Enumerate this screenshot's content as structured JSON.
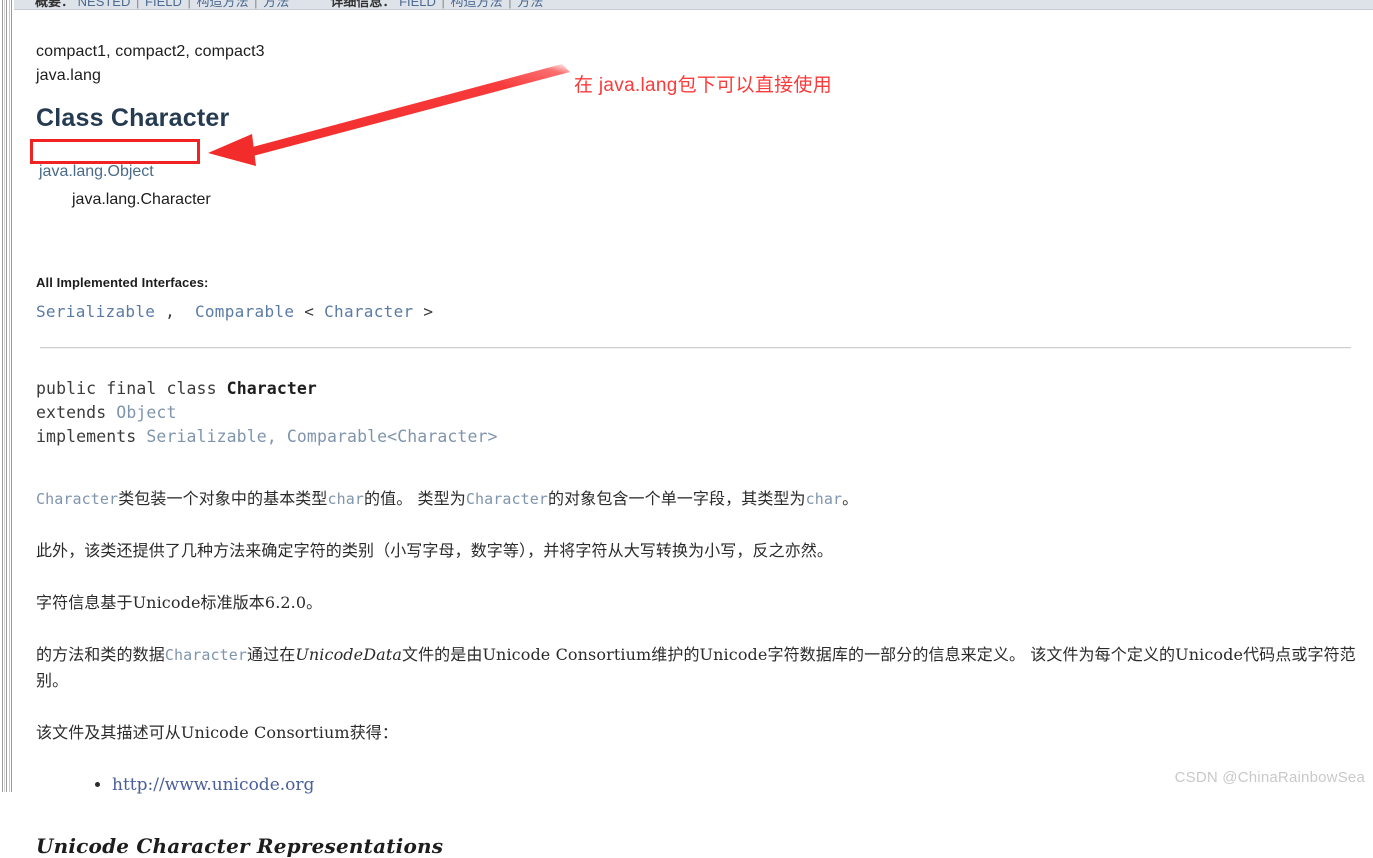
{
  "topnav": {
    "summary_label": "概要：",
    "summary_items": [
      "NESTED",
      "FIELD",
      "构造方法",
      "方法"
    ],
    "detail_label": "详细信息：",
    "detail_items": [
      "FIELD",
      "构造方法",
      "方法"
    ],
    "separator": "|"
  },
  "header": {
    "sub_packages": "compact1, compact2, compact3",
    "package_name": "java.lang",
    "class_title": "Class Character"
  },
  "inheritance": {
    "level0": "java.lang.Object",
    "level1": "java.lang.Character"
  },
  "annotation": {
    "text": "在 java.lang包下可以直接使用",
    "color": "#fb3a3a",
    "box_color": "#f02222"
  },
  "interfaces": {
    "heading": "All Implemented Interfaces:",
    "items": [
      "Serializable",
      "Comparable",
      "Character"
    ],
    "rendered": "Serializable ,  Comparable < Character >"
  },
  "declaration": {
    "line1_kw": "public final class ",
    "line1_name": "Character",
    "line2_kw": "extends ",
    "line2_type": "Object",
    "line3_kw": "implements ",
    "line3_type": "Serializable, Comparable<Character>"
  },
  "paragraphs": {
    "p1_a": "Character",
    "p1_b": "类包装一个对象中的基本类型",
    "p1_c": "char",
    "p1_d": "的值。 类型为",
    "p1_e": "Character",
    "p1_f": "的对象包含一个单一字段，其类型为",
    "p1_g": "char",
    "p1_h": "。",
    "p2": "此外，该类还提供了几种方法来确定字符的类别（小写字母，数字等），并将字符从大写转换为小写，反之亦然。",
    "p3": "字符信息基于Unicode标准版本6.2.0。",
    "p4_a": "的方法和类的数据",
    "p4_b": "Character",
    "p4_c": "通过在",
    "p4_d": "UnicodeData",
    "p4_e": "文件的是由Unicode Consortium维护的Unicode字符数据库的一部分的信息来定义。 该文件为每个定义的Unicode代码点或字符范别。",
    "p5": "该文件及其描述可从Unicode Consortium获得："
  },
  "links": {
    "unicode_org": "http://www.unicode.org"
  },
  "sections": {
    "unicode_char_repr": "Unicode Character Representations"
  },
  "watermark": {
    "text": "CSDN @ChinaRainbowSea"
  }
}
